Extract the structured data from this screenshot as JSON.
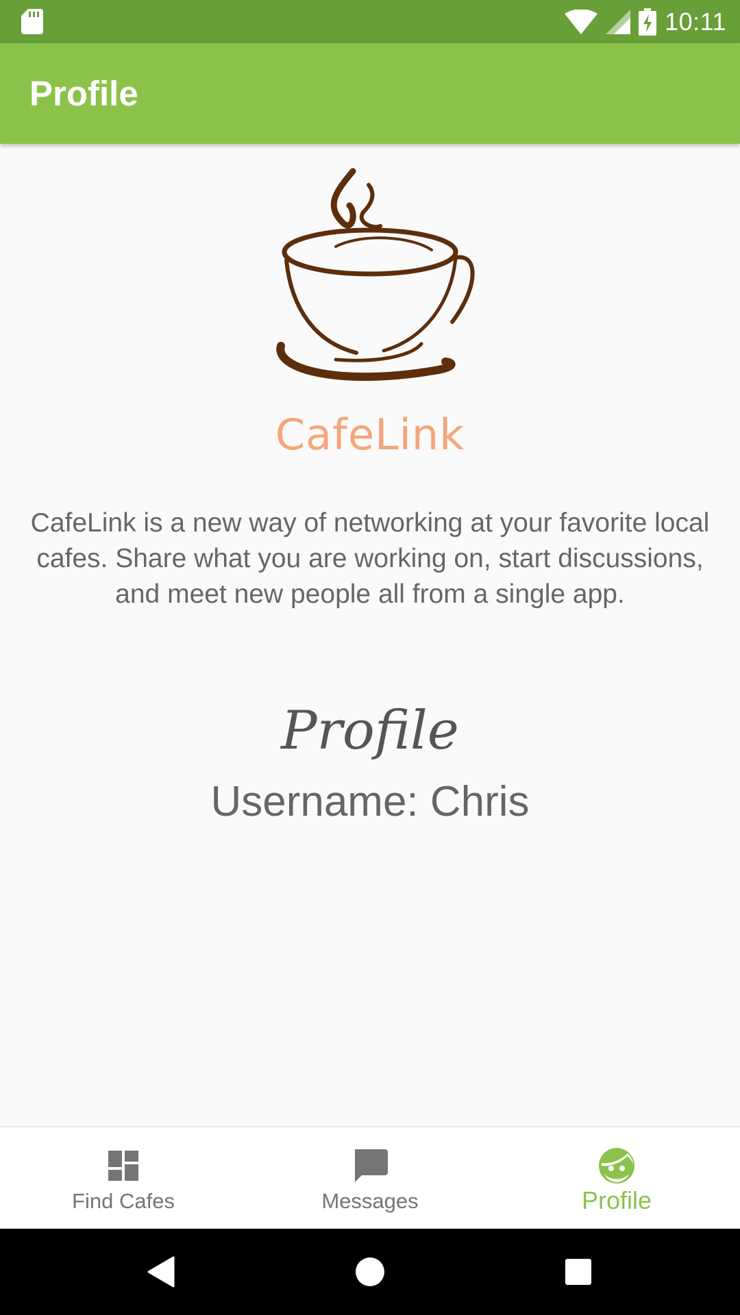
{
  "status_bar": {
    "time": "10:11",
    "icons": [
      "sd-card-icon",
      "wifi-icon",
      "signal-icon",
      "battery-charging-icon"
    ]
  },
  "app_bar": {
    "title": "Profile"
  },
  "logo": {
    "brand_text": "CafeLink",
    "icon": "coffee-cup-icon"
  },
  "description": "CafeLink is a new way of networking at your favorite local cafes. Share what you are working on, start discussions, and meet new people all from a single app.",
  "profile": {
    "heading": "Profile",
    "username_text": "Username: Chris"
  },
  "bottom_nav": {
    "items": [
      {
        "label": "Find Cafes",
        "icon": "dashboard-icon",
        "active": false
      },
      {
        "label": "Messages",
        "icon": "chat-icon",
        "active": false
      },
      {
        "label": "Profile",
        "icon": "face-icon",
        "active": true
      }
    ]
  },
  "system_nav": {
    "buttons": [
      "back-icon",
      "home-icon",
      "recents-icon"
    ]
  },
  "colors": {
    "status_bar": "#689f38",
    "app_bar": "#8bc34a",
    "accent": "#8bc34a",
    "brand_text": "#f5a57a",
    "coffee": "#5d2e0c",
    "background": "#fafafa"
  }
}
